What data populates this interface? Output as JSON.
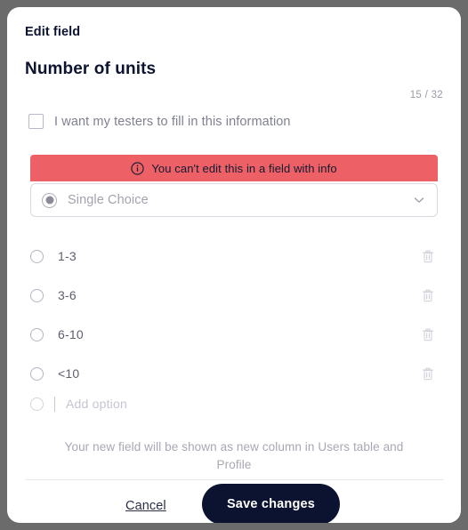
{
  "dialog": {
    "eyebrow": "Edit field",
    "field_title": "Number of units",
    "char_counter": "15 / 32"
  },
  "testers_checkbox": {
    "label": "I want my testers to fill in this information",
    "checked": false
  },
  "warning": {
    "icon": "info-icon",
    "text": "You can't edit this in a field with info",
    "background_color": "#ED6065"
  },
  "field_type_select": {
    "icon": "radio-filled-icon",
    "value": "Single Choice",
    "chevron": "chevron-down-icon"
  },
  "options": [
    {
      "label": "1-3",
      "delete_icon": "trash-icon"
    },
    {
      "label": "3-6",
      "delete_icon": "trash-icon"
    },
    {
      "label": "6-10",
      "delete_icon": "trash-icon"
    },
    {
      "label": "<10",
      "delete_icon": "trash-icon"
    }
  ],
  "add_option": {
    "placeholder": "Add option",
    "value": ""
  },
  "footer": {
    "hint": "Your new field will be shown as new column in Users table and Profile",
    "cancel_label": "Cancel",
    "save_label": "Save changes",
    "save_button_color": "#0C1330"
  }
}
